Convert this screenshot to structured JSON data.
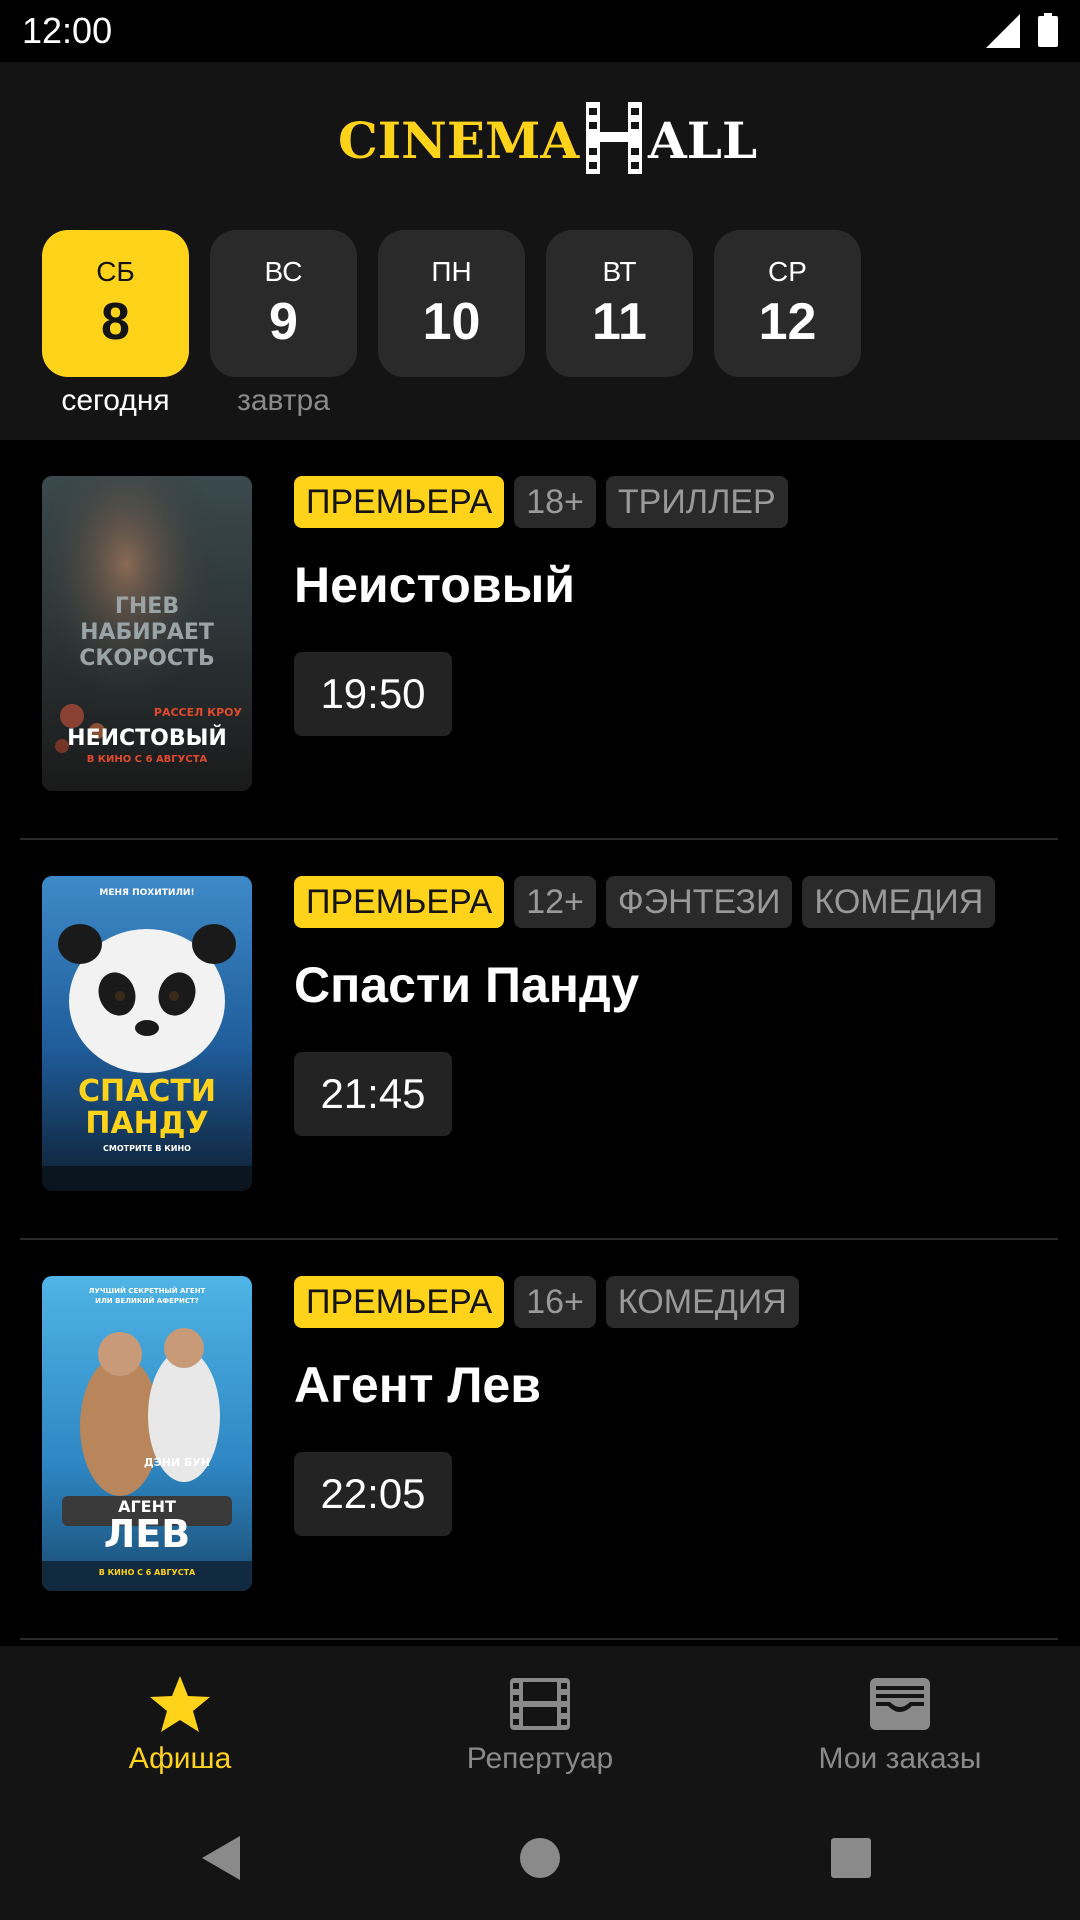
{
  "status_bar": {
    "time": "12:00"
  },
  "app": {
    "logo_text_left": "CINEMA",
    "logo_text_right": "ALL",
    "accent_color": "#ffd31a"
  },
  "dates": [
    {
      "dow": "СБ",
      "day": "8",
      "sub": "сегодня",
      "active": true
    },
    {
      "dow": "ВС",
      "day": "9",
      "sub": "завтра",
      "active": false
    },
    {
      "dow": "ПН",
      "day": "10",
      "sub": "",
      "active": false
    },
    {
      "dow": "ВТ",
      "day": "11",
      "sub": "",
      "active": false
    },
    {
      "dow": "СР",
      "day": "12",
      "sub": "",
      "active": false
    }
  ],
  "movies": [
    {
      "badge": "ПРЕМЬЕРА",
      "age": "18+",
      "genres": [
        "ТРИЛЛЕР"
      ],
      "title": "Неистовый",
      "session": "19:50",
      "poster": {
        "tagline": [
          "ГНЕВ",
          "НАБИРАЕТ",
          "СКОРОСТЬ"
        ],
        "actor": "РАССЕЛ КРОУ",
        "title": "НЕИСТОВЫЙ",
        "release": "В КИНО С 6 АВГУСТА"
      }
    },
    {
      "badge": "ПРЕМЬЕРА",
      "age": "12+",
      "genres": [
        "ФЭНТЕЗИ",
        "КОМЕДИЯ"
      ],
      "title": "Спасти Панду",
      "session": "21:45",
      "poster": {
        "tagline": [
          "МЕНЯ ПОХИТИЛИ!"
        ],
        "title_line1": "СПАСТИ",
        "title_line2": "ПАНДУ",
        "release": "СМОТРИТЕ В КИНО"
      }
    },
    {
      "badge": "ПРЕМЬЕРА",
      "age": "16+",
      "genres": [
        "КОМЕДИЯ"
      ],
      "title": "Агент Лев",
      "session": "22:05",
      "poster": {
        "tagline": [
          "ЛУЧШИЙ СЕКРЕТНЫЙ АГЕНТ",
          "ИЛИ ВЕЛИКИЙ АФЕРИСТ?"
        ],
        "actor": "ДЭНИ БУН",
        "title_line1": "АГЕНТ",
        "title_line2": "ЛЕВ",
        "release": "В КИНО С 6 АВГУСТА"
      }
    }
  ],
  "bottom_nav": [
    {
      "label": "Афиша",
      "icon": "star-icon",
      "active": true
    },
    {
      "label": "Репертуар",
      "icon": "film-icon",
      "active": false
    },
    {
      "label": "Мои заказы",
      "icon": "tickets-icon",
      "active": false
    }
  ],
  "system_nav": [
    "back-icon",
    "home-icon",
    "recents-icon"
  ]
}
